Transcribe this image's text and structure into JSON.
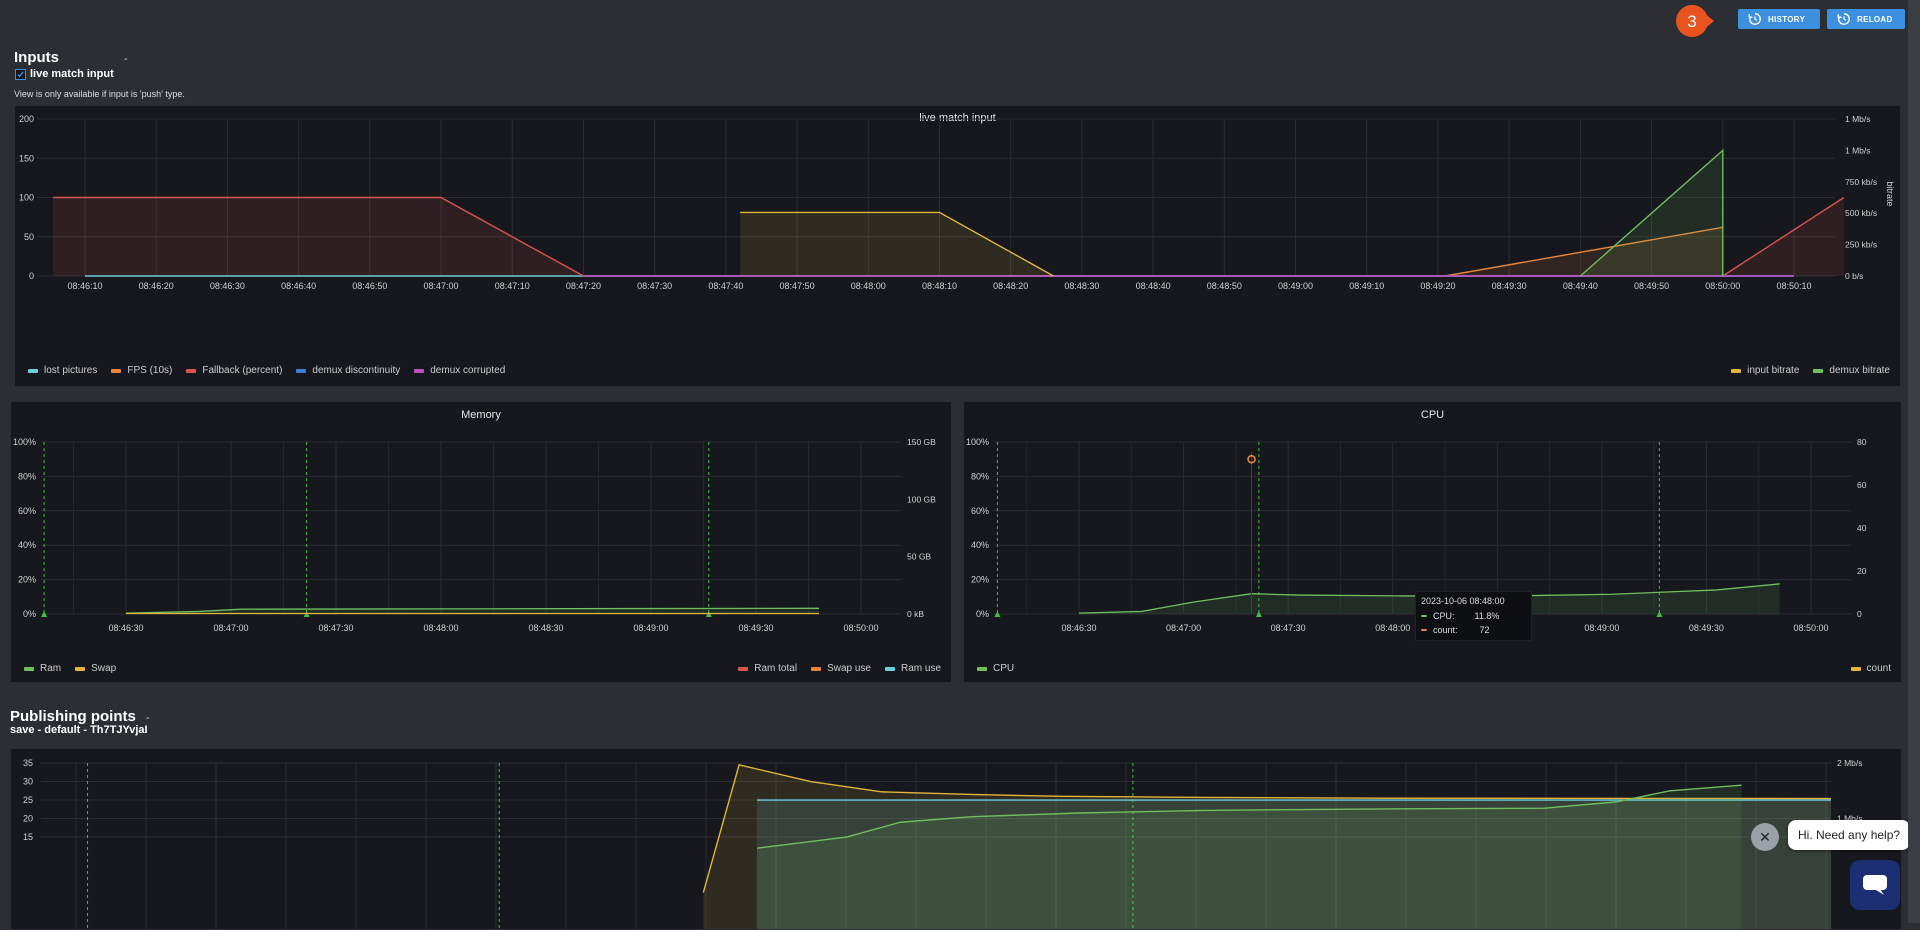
{
  "header": {
    "history_label": "HISTORY",
    "reload_label": "RELOAD",
    "step_badge": "3"
  },
  "inputs": {
    "title": "Inputs",
    "checkbox_label": "live match input",
    "note": "View is only available if input is 'push' type.",
    "dash": "-"
  },
  "publishing": {
    "title": "Publishing points",
    "subtitle": "save - default - Th7TJYvjaI",
    "dash": "-"
  },
  "tooltip": {
    "timestamp": "2023-10-06 08:48:00",
    "cpu_label": "CPU:",
    "cpu_value": "11.8%",
    "count_label": "count:",
    "count_value": "72"
  },
  "chat": {
    "bubble_text": "Hi. Need any help?",
    "close_glyph": "✕"
  },
  "colors": {
    "lost_pictures": "#6ccfe0",
    "fps": "#e8853d",
    "fallback": "#d9534f",
    "demux_discontinuity": "#3b82d6",
    "demux_corrupted": "#c04fc1",
    "input_bitrate": "#e3b53b",
    "demux_bitrate": "#6fbf5f",
    "ram": "#6fbf5f",
    "swap": "#e3b53b",
    "cpu": "#6fbf5f"
  },
  "chart_data": [
    {
      "type": "area",
      "title": "live match input",
      "x": [
        "08:46:10",
        "08:46:20",
        "08:46:30",
        "08:46:40",
        "08:46:50",
        "08:47:00",
        "08:47:10",
        "08:47:20",
        "08:47:30",
        "08:47:40",
        "08:47:50",
        "08:48:00",
        "08:48:10",
        "08:48:20",
        "08:48:30",
        "08:48:40",
        "08:48:50",
        "08:49:00",
        "08:49:10",
        "08:49:20",
        "08:49:30",
        "08:49:40",
        "08:49:50",
        "08:50:00",
        "08:50:10"
      ],
      "yleft_ticks": [
        "0",
        "50",
        "100",
        "150",
        "200"
      ],
      "yright_ticks": [
        "0 b/s",
        "250 kb/s",
        "500 kb/s",
        "750 kb/s",
        "1 Mb/s",
        "1 Mb/s"
      ],
      "yright_label": "bitrate",
      "ylim": [
        0,
        200
      ],
      "series": [
        {
          "name": "lost pictures",
          "color": "#6ccfe0",
          "points": [
            [
              0,
              0
            ],
            [
              24,
              0
            ]
          ]
        },
        {
          "name": "FPS (10s)",
          "color": "#e8853d",
          "points": [
            [
              19.1,
              0
            ],
            [
              23.0,
              62
            ]
          ]
        },
        {
          "name": "Fallback (percent)",
          "color": "#d9534f",
          "points": [
            [
              -0.45,
              100
            ],
            [
              5.0,
              100
            ],
            [
              7.0,
              0
            ],
            [
              23.0,
              0
            ],
            [
              24.7,
              100
            ]
          ]
        },
        {
          "name": "demux discontinuity",
          "color": "#3b82d6",
          "points": [
            [
              7.0,
              0
            ],
            [
              24.0,
              0
            ]
          ]
        },
        {
          "name": "demux corrupted",
          "color": "#c04fc1",
          "points": [
            [
              7.0,
              0
            ],
            [
              24.0,
              0
            ]
          ]
        },
        {
          "name": "input bitrate",
          "color": "#e3b53b",
          "points": [
            [
              9.2,
              81
            ],
            [
              12.0,
              81
            ],
            [
              13.6,
              0
            ]
          ]
        },
        {
          "name": "demux bitrate",
          "color": "#6fbf5f",
          "points": [
            [
              21.0,
              0
            ],
            [
              23.0,
              160
            ],
            [
              23.0,
              0
            ]
          ]
        }
      ],
      "legend_left": [
        "lost pictures",
        "FPS (10s)",
        "Fallback (percent)",
        "demux discontinuity",
        "demux corrupted"
      ],
      "legend_right": [
        "input bitrate",
        "demux bitrate"
      ]
    },
    {
      "type": "line",
      "title": "Memory",
      "x_ticks": [
        "08:46:30",
        "08:47:00",
        "08:47:30",
        "08:48:00",
        "08:48:30",
        "08:49:00",
        "08:49:30",
        "08:50:00"
      ],
      "yleft_ticks": [
        "0%",
        "20%",
        "40%",
        "60%",
        "80%",
        "100%"
      ],
      "yright_ticks": [
        "0 kB",
        "50 GB",
        "100 GB",
        "150 GB"
      ],
      "ylim": [
        0,
        100
      ],
      "series": [
        {
          "name": "Ram",
          "color": "#6fbf5f",
          "points": [
            [
              0.9,
              0.5
            ],
            [
              1.6,
              1.5
            ],
            [
              2.0,
              2.8
            ],
            [
              4.0,
              3.0
            ],
            [
              7.5,
              3.3
            ]
          ]
        },
        {
          "name": "Swap",
          "color": "#e3b53b",
          "points": [
            [
              0.9,
              0.3
            ],
            [
              7.5,
              0.3
            ]
          ]
        }
      ],
      "legend_left": [
        "Ram",
        "Swap"
      ],
      "legend_right": [
        "Ram total",
        "Swap use",
        "Ram use"
      ],
      "legend_right_colors": [
        "#d9534f",
        "#e8853d",
        "#6ccfe0"
      ]
    },
    {
      "type": "line",
      "title": "CPU",
      "x_ticks": [
        "08:46:30",
        "08:47:00",
        "08:47:30",
        "08:48:00",
        "08:48:30",
        "08:49:00",
        "08:49:30",
        "08:50:00"
      ],
      "yleft_ticks": [
        "0%",
        "20%",
        "40%",
        "60%",
        "80%",
        "100%"
      ],
      "yright_ticks": [
        "0",
        "20",
        "40",
        "60",
        "80"
      ],
      "ylim": [
        0,
        100
      ],
      "series": [
        {
          "name": "CPU",
          "color": "#6fbf5f",
          "points": [
            [
              0.9,
              0.5
            ],
            [
              1.5,
              1.5
            ],
            [
              2.0,
              7
            ],
            [
              2.55,
              11.8
            ],
            [
              3.0,
              11
            ],
            [
              4.0,
              10.5
            ],
            [
              5.0,
              10.5
            ],
            [
              6.0,
              11.5
            ],
            [
              7.0,
              14
            ],
            [
              7.6,
              17.5
            ]
          ]
        },
        {
          "name": "count",
          "color": "#e3b53b",
          "points": [
            [
              2.55,
              72
            ]
          ]
        }
      ],
      "legend_left": [
        "CPU"
      ],
      "legend_right": [
        "count"
      ]
    },
    {
      "type": "area",
      "title": "",
      "yleft_ticks": [
        "35",
        "30",
        "25",
        "20",
        "15"
      ],
      "yright_ticks": [
        "2 Mb/s",
        "1 Mb/s"
      ],
      "series": [
        {
          "name": "",
          "color": "#e3b53b",
          "points": [
            [
              0.37,
              0
            ],
            [
              0.39,
              34.5
            ],
            [
              0.43,
              30
            ],
            [
              0.47,
              27.2
            ],
            [
              0.52,
              26.5
            ],
            [
              0.57,
              26
            ],
            [
              0.65,
              25.7
            ],
            [
              0.75,
              25.5
            ],
            [
              1.0,
              25.4
            ]
          ]
        },
        {
          "name": "",
          "color": "#6ccfe0",
          "points": [
            [
              0.4,
              25
            ],
            [
              1.0,
              25
            ]
          ]
        },
        {
          "name": "",
          "color": "#6fbf5f",
          "points": [
            [
              0.4,
              12
            ],
            [
              0.45,
              15
            ],
            [
              0.48,
              19
            ],
            [
              0.52,
              20.5
            ],
            [
              0.58,
              21.5
            ],
            [
              0.65,
              22.2
            ],
            [
              0.75,
              22.6
            ],
            [
              0.84,
              22.8
            ],
            [
              0.88,
              24.5
            ],
            [
              0.91,
              27.5
            ],
            [
              0.95,
              29
            ]
          ]
        }
      ]
    }
  ]
}
